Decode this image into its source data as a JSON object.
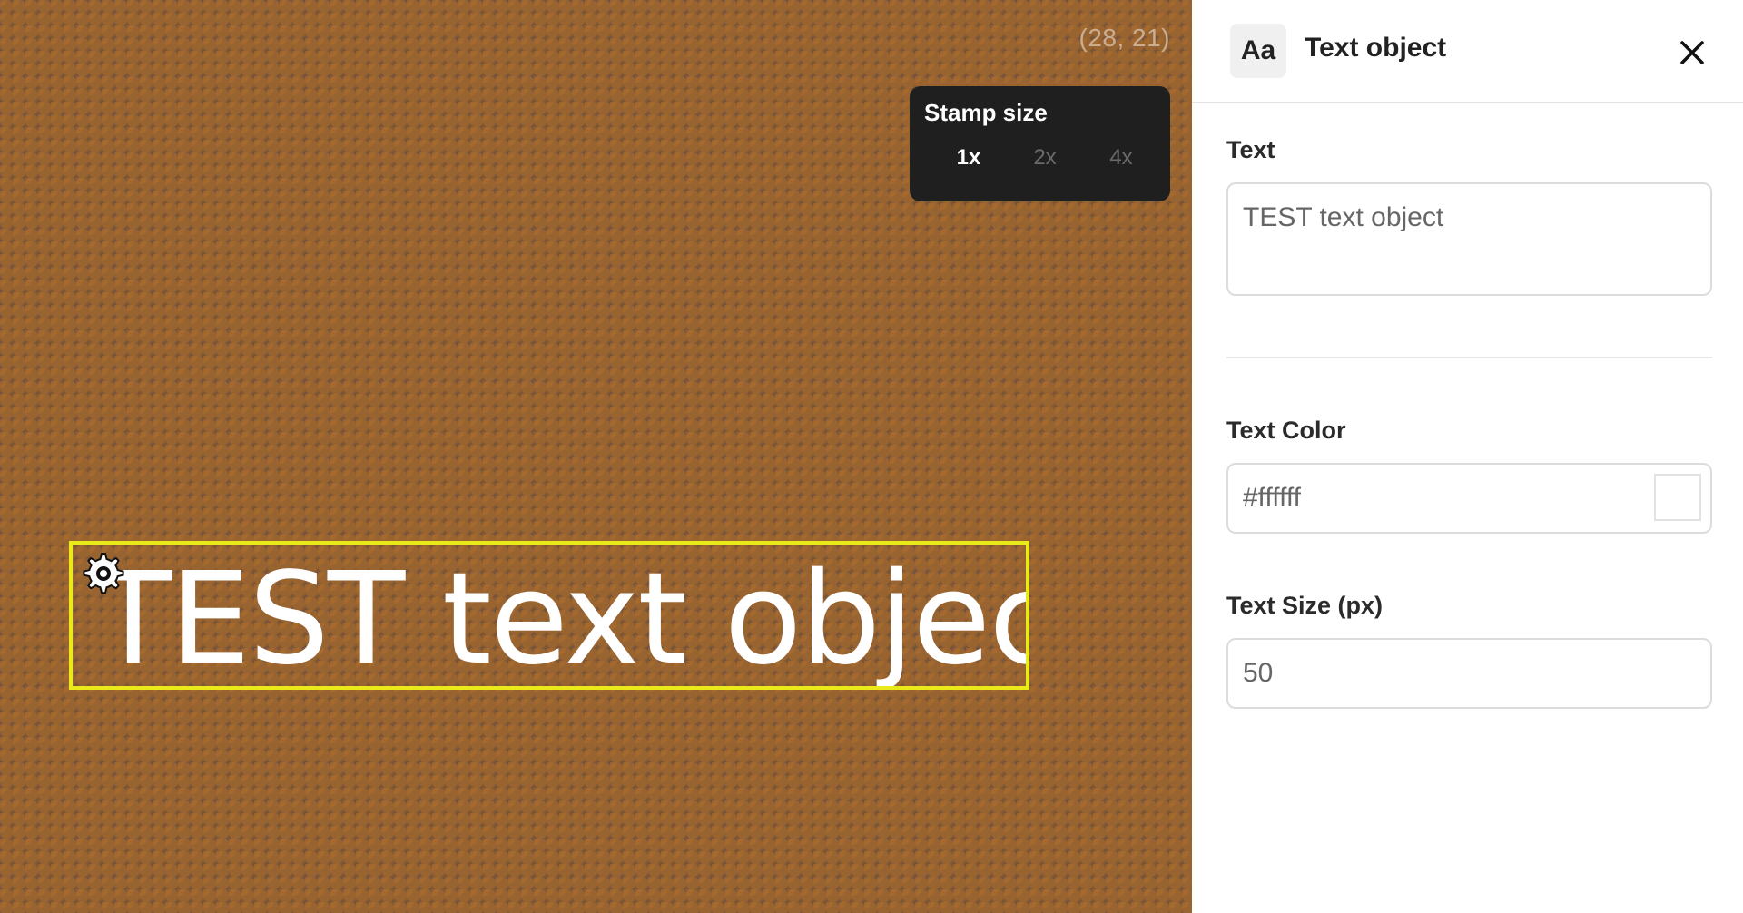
{
  "canvas": {
    "coordinates": "(28, 21)",
    "stamp_size": {
      "title": "Stamp size",
      "options": [
        "1x",
        "2x",
        "4x"
      ],
      "selected": "1x"
    },
    "text_object": {
      "text": "TEST text object",
      "color": "#ffffff",
      "selection_color": "#eaea1a",
      "handle_icon": "gear-icon"
    }
  },
  "panel": {
    "badge": "Aa",
    "title": "Text object",
    "close_icon": "close-icon",
    "text_label": "Text",
    "text_value": "TEST text object",
    "color_label": "Text Color",
    "color_value": "#ffffff",
    "size_label": "Text Size (px)",
    "size_value": "50"
  }
}
